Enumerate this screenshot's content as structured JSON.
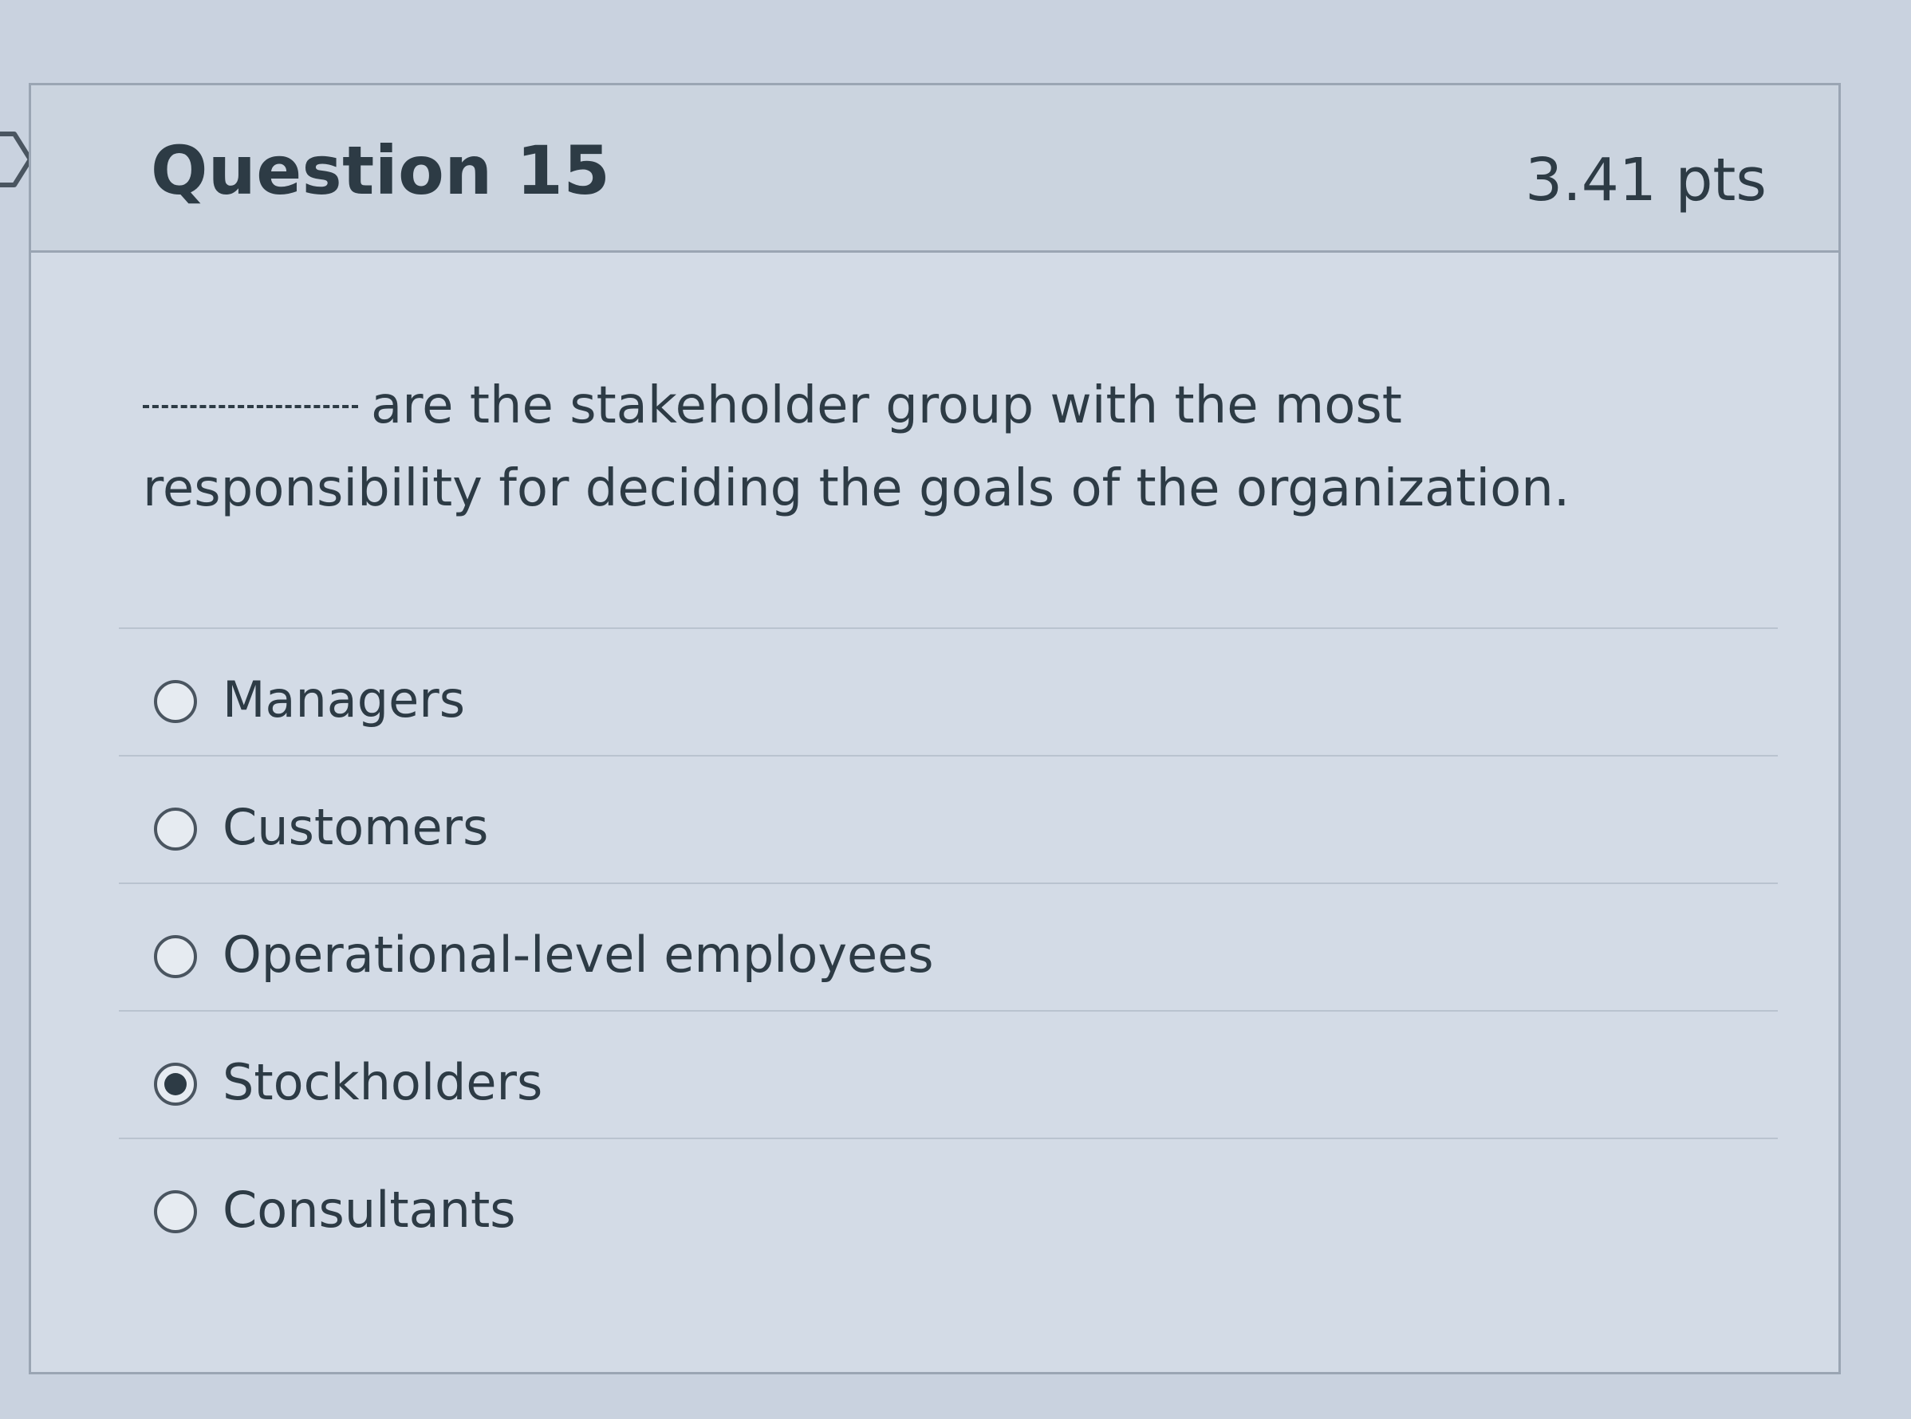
{
  "question": {
    "title": "Question 15",
    "points": "3.41 pts",
    "blank": "________",
    "text": "are the stakeholder group with the most responsibility for deciding the goals of the organization."
  },
  "answers": [
    {
      "label": "Managers",
      "selected": false
    },
    {
      "label": "Customers",
      "selected": false
    },
    {
      "label": "Operational-level employees",
      "selected": false
    },
    {
      "label": "Stockholders",
      "selected": true
    },
    {
      "label": "Consultants",
      "selected": false
    }
  ],
  "icons": {
    "flag": "flag-marker-icon"
  }
}
